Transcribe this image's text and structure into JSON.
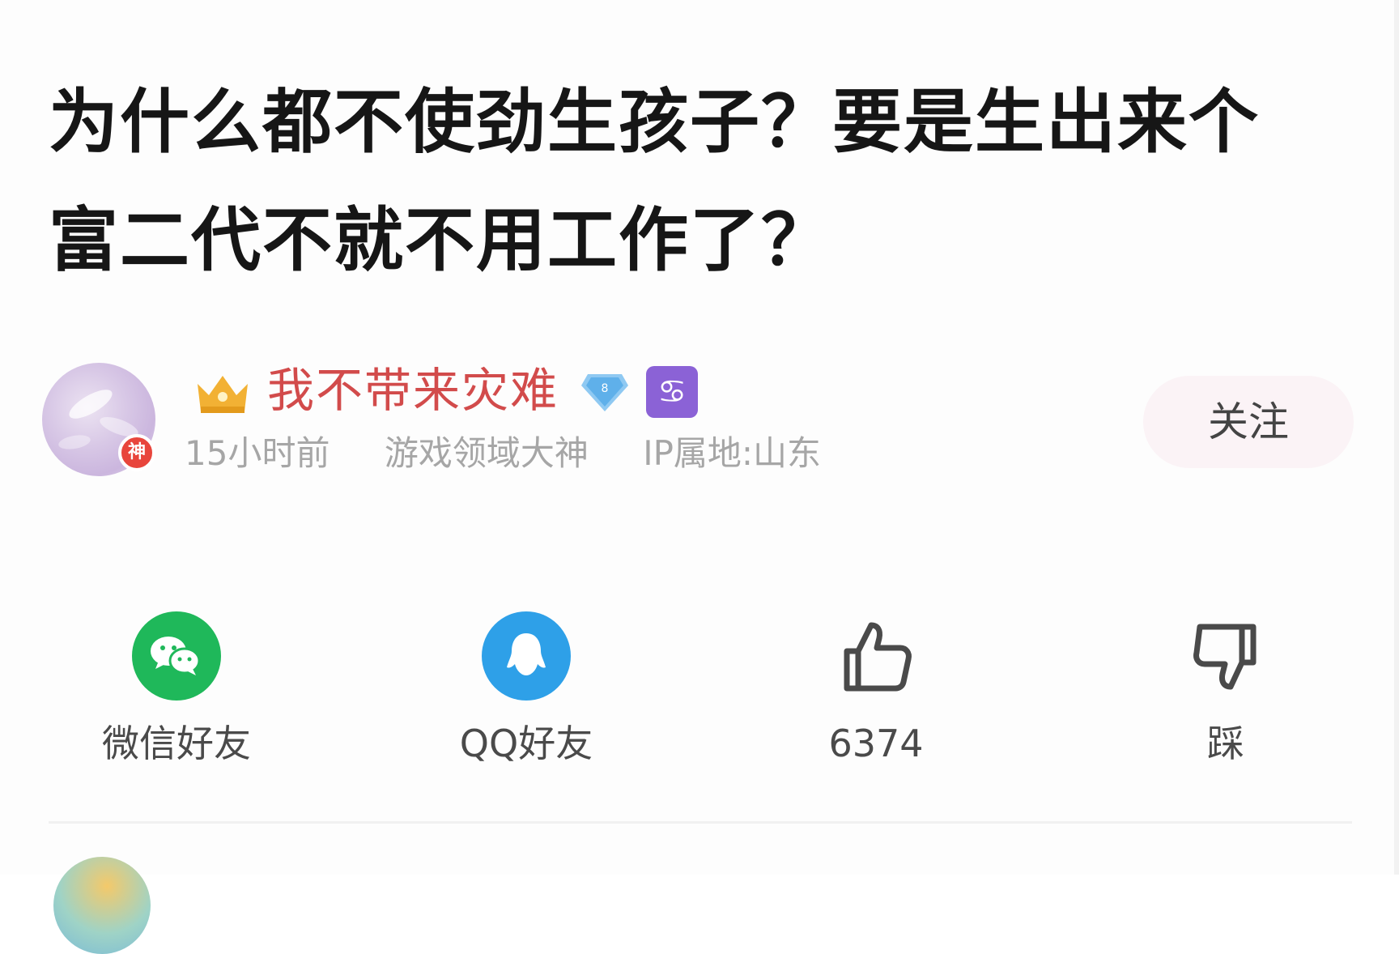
{
  "post": {
    "title": "为什么都不使劲生孩子？要是生出来个富二代不就不用工作了？"
  },
  "author": {
    "name": "我不带来灾难",
    "avatar_badge": "神",
    "level": "8",
    "zodiac_symbol": "♋",
    "time": "15小时前",
    "title_tag": "游戏领域大神",
    "ip_location": "IP属地:山东",
    "follow_label": "关注",
    "name_color": "#d24b4b"
  },
  "actions": {
    "wechat_label": "微信好友",
    "qq_label": "QQ好友",
    "like_count": "6374",
    "dislike_label": "踩"
  },
  "colors": {
    "wechat": "#1fb85a",
    "qq": "#2ea0e8",
    "zodiac_badge": "#8b62d6",
    "crown": "#f2b134"
  }
}
